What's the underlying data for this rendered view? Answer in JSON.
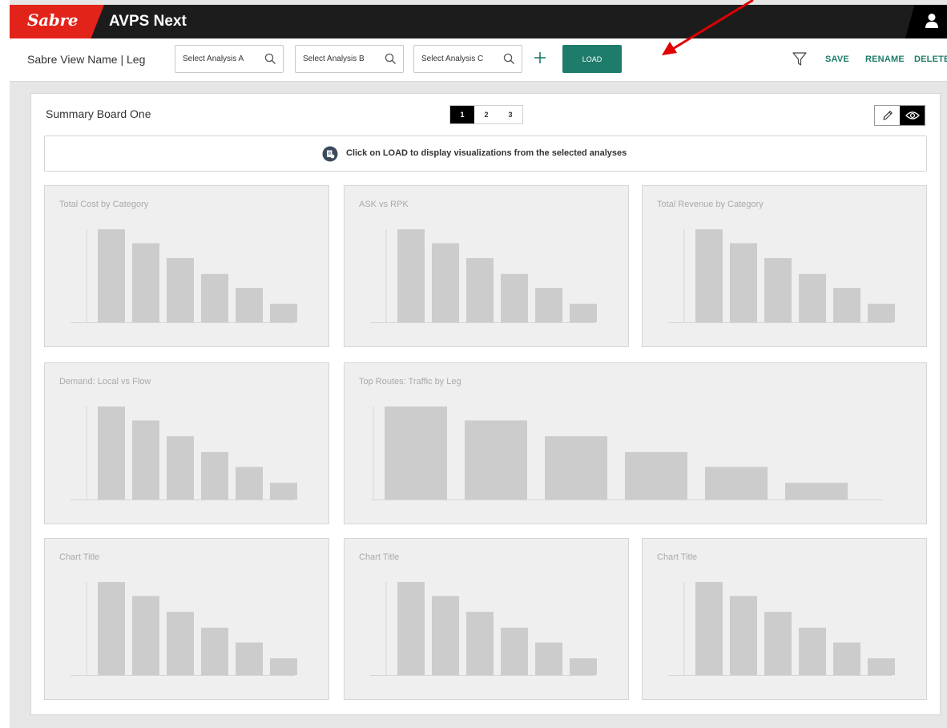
{
  "app": {
    "brand": "Sabre",
    "name": "AVPS Next"
  },
  "toolbar": {
    "view_name": "Sabre View Name | Leg",
    "analysis_a_placeholder": "Select Analysis A",
    "analysis_b_placeholder": "Select Analysis B",
    "analysis_c_placeholder": "Select Analysis C",
    "load_label": "LOAD",
    "save_label": "SAVE",
    "rename_label": "RENAME",
    "delete_label": "DELETE"
  },
  "board": {
    "title": "Summary Board One",
    "pages": [
      "1",
      "2",
      "3"
    ],
    "active_page": "1",
    "info_message": "Click on LOAD to display visualizations from the selected analyses"
  },
  "colors": {
    "brand_red": "#e2231a",
    "topbar": "#1c1c1c",
    "accent_green": "#1e7c6a",
    "placeholder_bar": "#cccccc",
    "annotation_arrow": "#e00000"
  },
  "chart_data": [
    {
      "type": "bar",
      "title": "Total Cost by Category",
      "values": [
        100,
        85,
        69,
        52,
        37,
        20
      ],
      "ylim": [
        0,
        100
      ]
    },
    {
      "type": "bar",
      "title": "ASK vs RPK",
      "values": [
        100,
        85,
        69,
        52,
        37,
        20
      ],
      "ylim": [
        0,
        100
      ]
    },
    {
      "type": "bar",
      "title": "Total Revenue by Category",
      "values": [
        100,
        85,
        69,
        52,
        37,
        20
      ],
      "ylim": [
        0,
        100
      ]
    },
    {
      "type": "bar",
      "title": "Demand: Local vs Flow",
      "values": [
        100,
        85,
        68,
        51,
        35,
        18
      ],
      "ylim": [
        0,
        100
      ]
    },
    {
      "type": "bar",
      "title": "Top Routes: Traffic by Leg",
      "values": [
        100,
        85,
        68,
        51,
        35,
        18
      ],
      "ylim": [
        0,
        100
      ]
    },
    {
      "type": "bar",
      "title": "Chart Title",
      "values": [
        100,
        85,
        68,
        51,
        35,
        18
      ],
      "ylim": [
        0,
        100
      ]
    },
    {
      "type": "bar",
      "title": "Chart Title",
      "values": [
        100,
        85,
        68,
        51,
        35,
        18
      ],
      "ylim": [
        0,
        100
      ]
    },
    {
      "type": "bar",
      "title": "Chart Title",
      "values": [
        100,
        85,
        68,
        51,
        35,
        18
      ],
      "ylim": [
        0,
        100
      ]
    }
  ]
}
